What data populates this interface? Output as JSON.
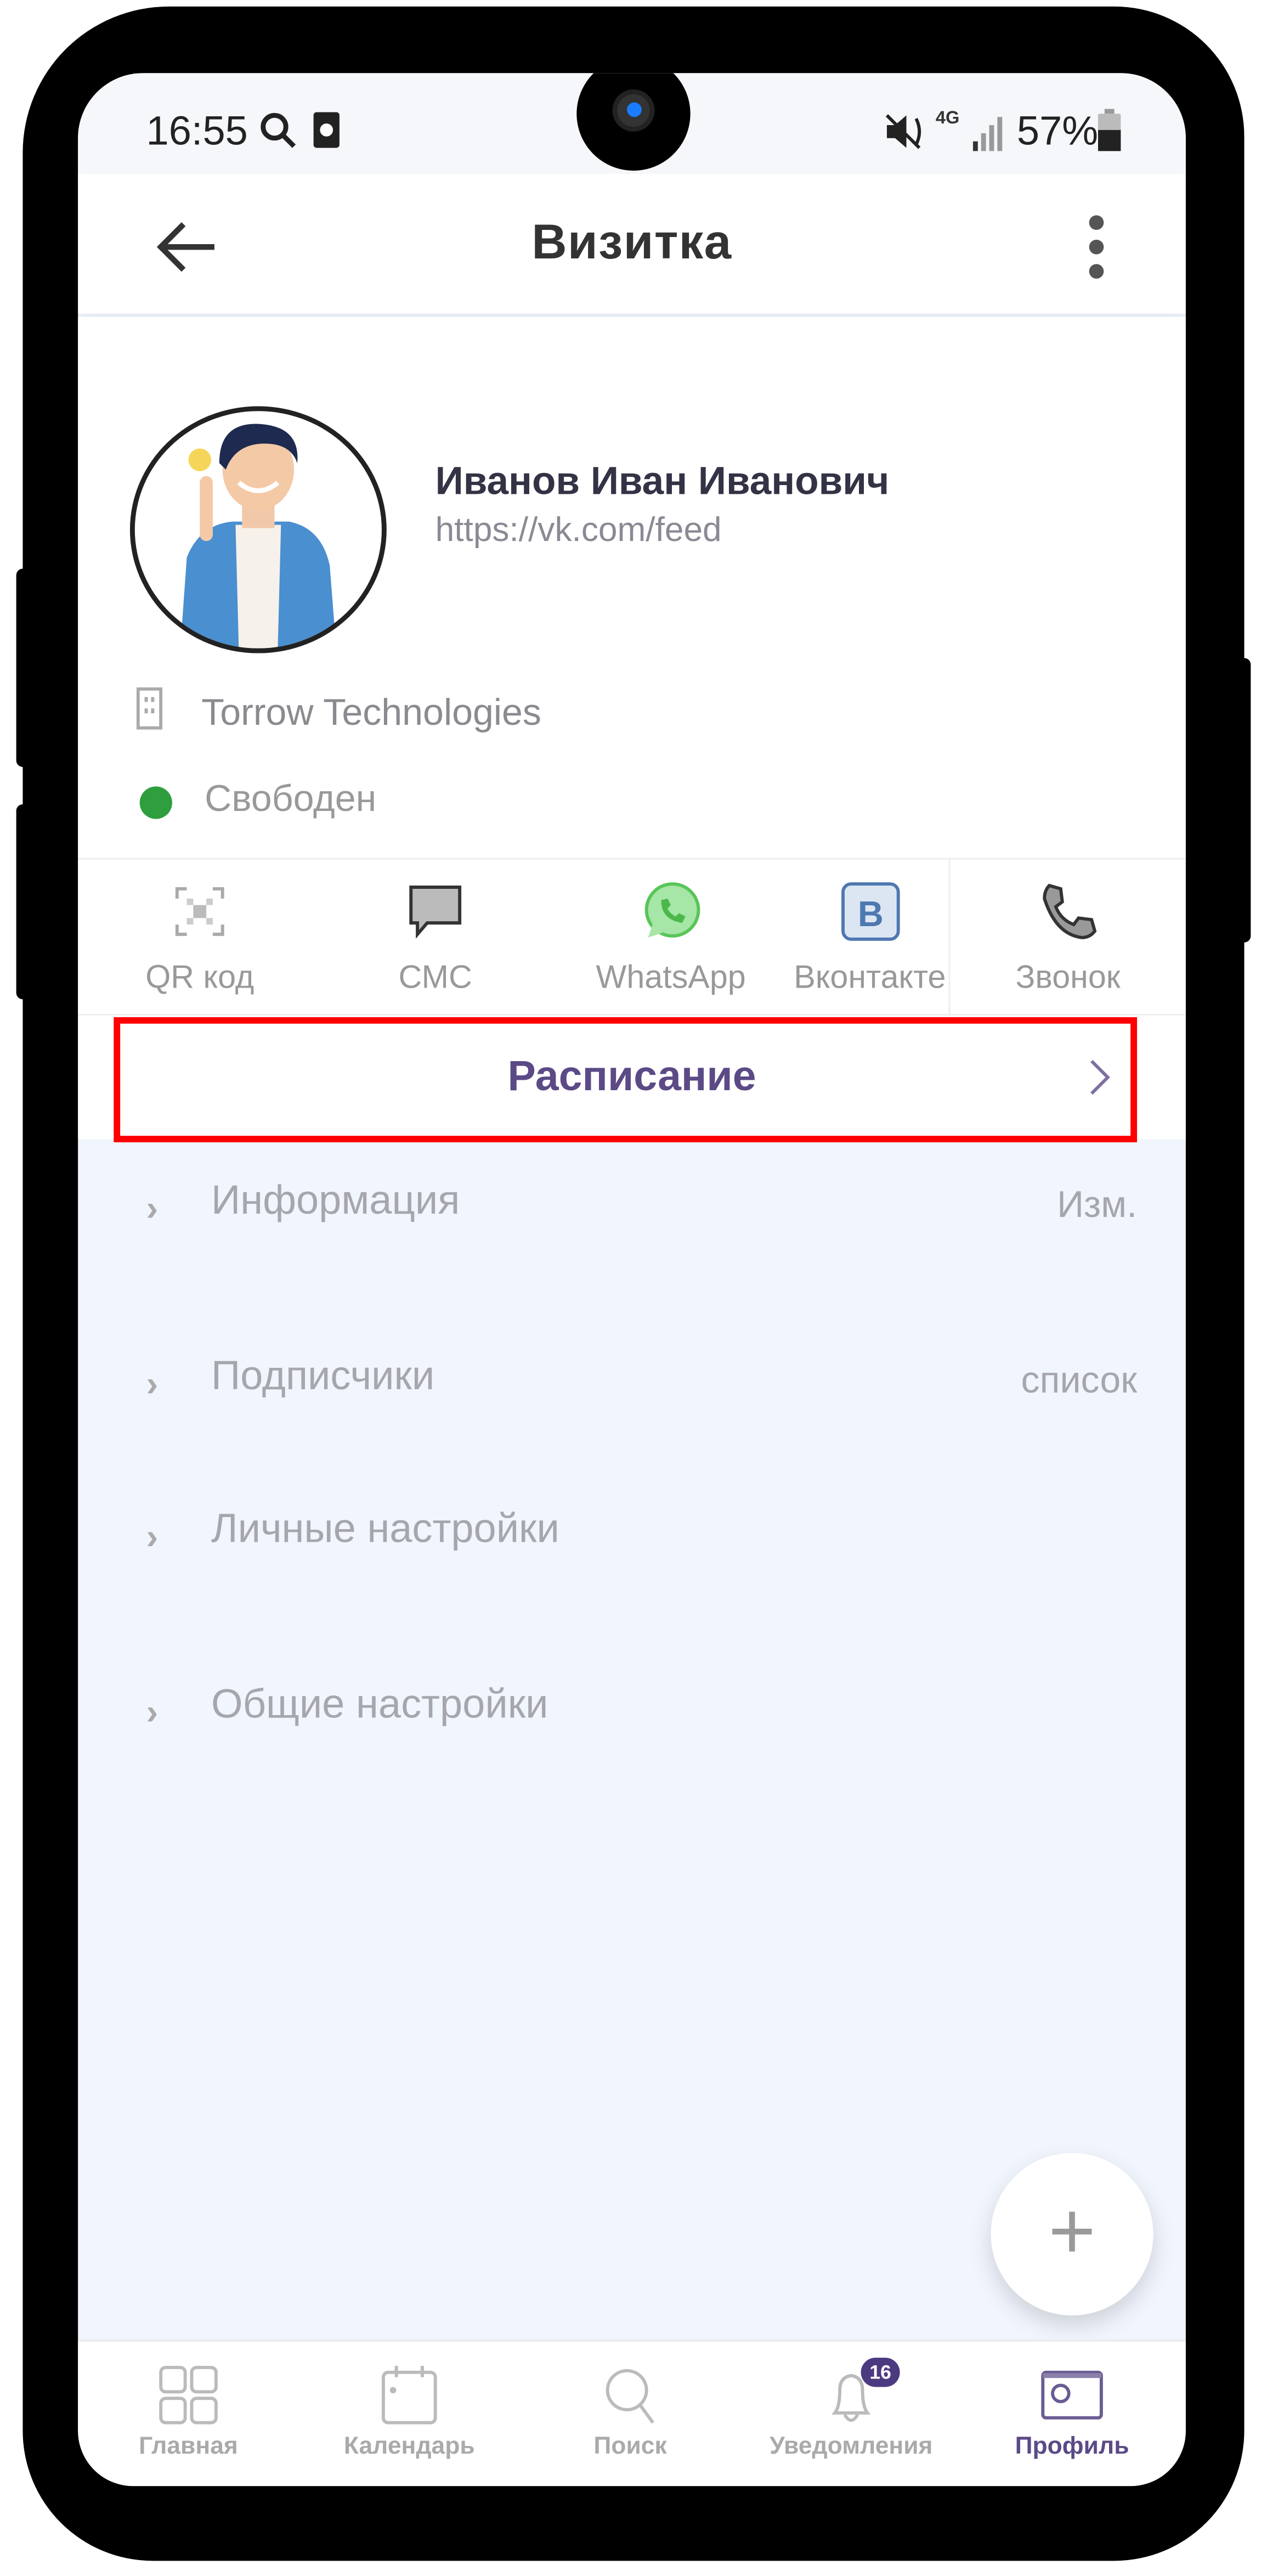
{
  "status_bar": {
    "time": "16:55",
    "battery": "57%",
    "network": "4G"
  },
  "header": {
    "title": "Визитка",
    "back_icon": "arrow-left-icon",
    "menu_icon": "more-vertical-icon"
  },
  "profile": {
    "name": "Иванов Иван Иванович",
    "link": "https://vk.com/feed",
    "company": "Torrow Technologies",
    "status": "Свободен",
    "status_color": "#2e9e3e"
  },
  "actions": [
    {
      "label": "QR код",
      "icon": "qr-code-icon"
    },
    {
      "label": "СМС",
      "icon": "message-icon"
    },
    {
      "label": "WhatsApp",
      "icon": "whatsapp-icon"
    },
    {
      "label": "Вконтакте",
      "icon": "vk-icon"
    },
    {
      "label": "Звонок",
      "icon": "phone-icon"
    }
  ],
  "schedule": {
    "label": "Расписание",
    "highlight_color": "#ff0000"
  },
  "sections": [
    {
      "label": "Информация",
      "action": "Изм."
    },
    {
      "label": "Подписчики",
      "action": "список"
    },
    {
      "label": "Личные настройки"
    },
    {
      "label": "Общие настройки"
    }
  ],
  "fab": {
    "icon": "plus-icon"
  },
  "bottom_nav": [
    {
      "label": "Главная",
      "icon": "grid-icon"
    },
    {
      "label": "Календарь",
      "icon": "calendar-icon"
    },
    {
      "label": "Поиск",
      "icon": "search-icon"
    },
    {
      "label": "Уведомления",
      "icon": "bell-icon",
      "badge": "16"
    },
    {
      "label": "Профиль",
      "icon": "profile-card-icon",
      "active": true
    }
  ],
  "colors": {
    "accent": "#5b4a86",
    "background": "#f1f5fd"
  }
}
